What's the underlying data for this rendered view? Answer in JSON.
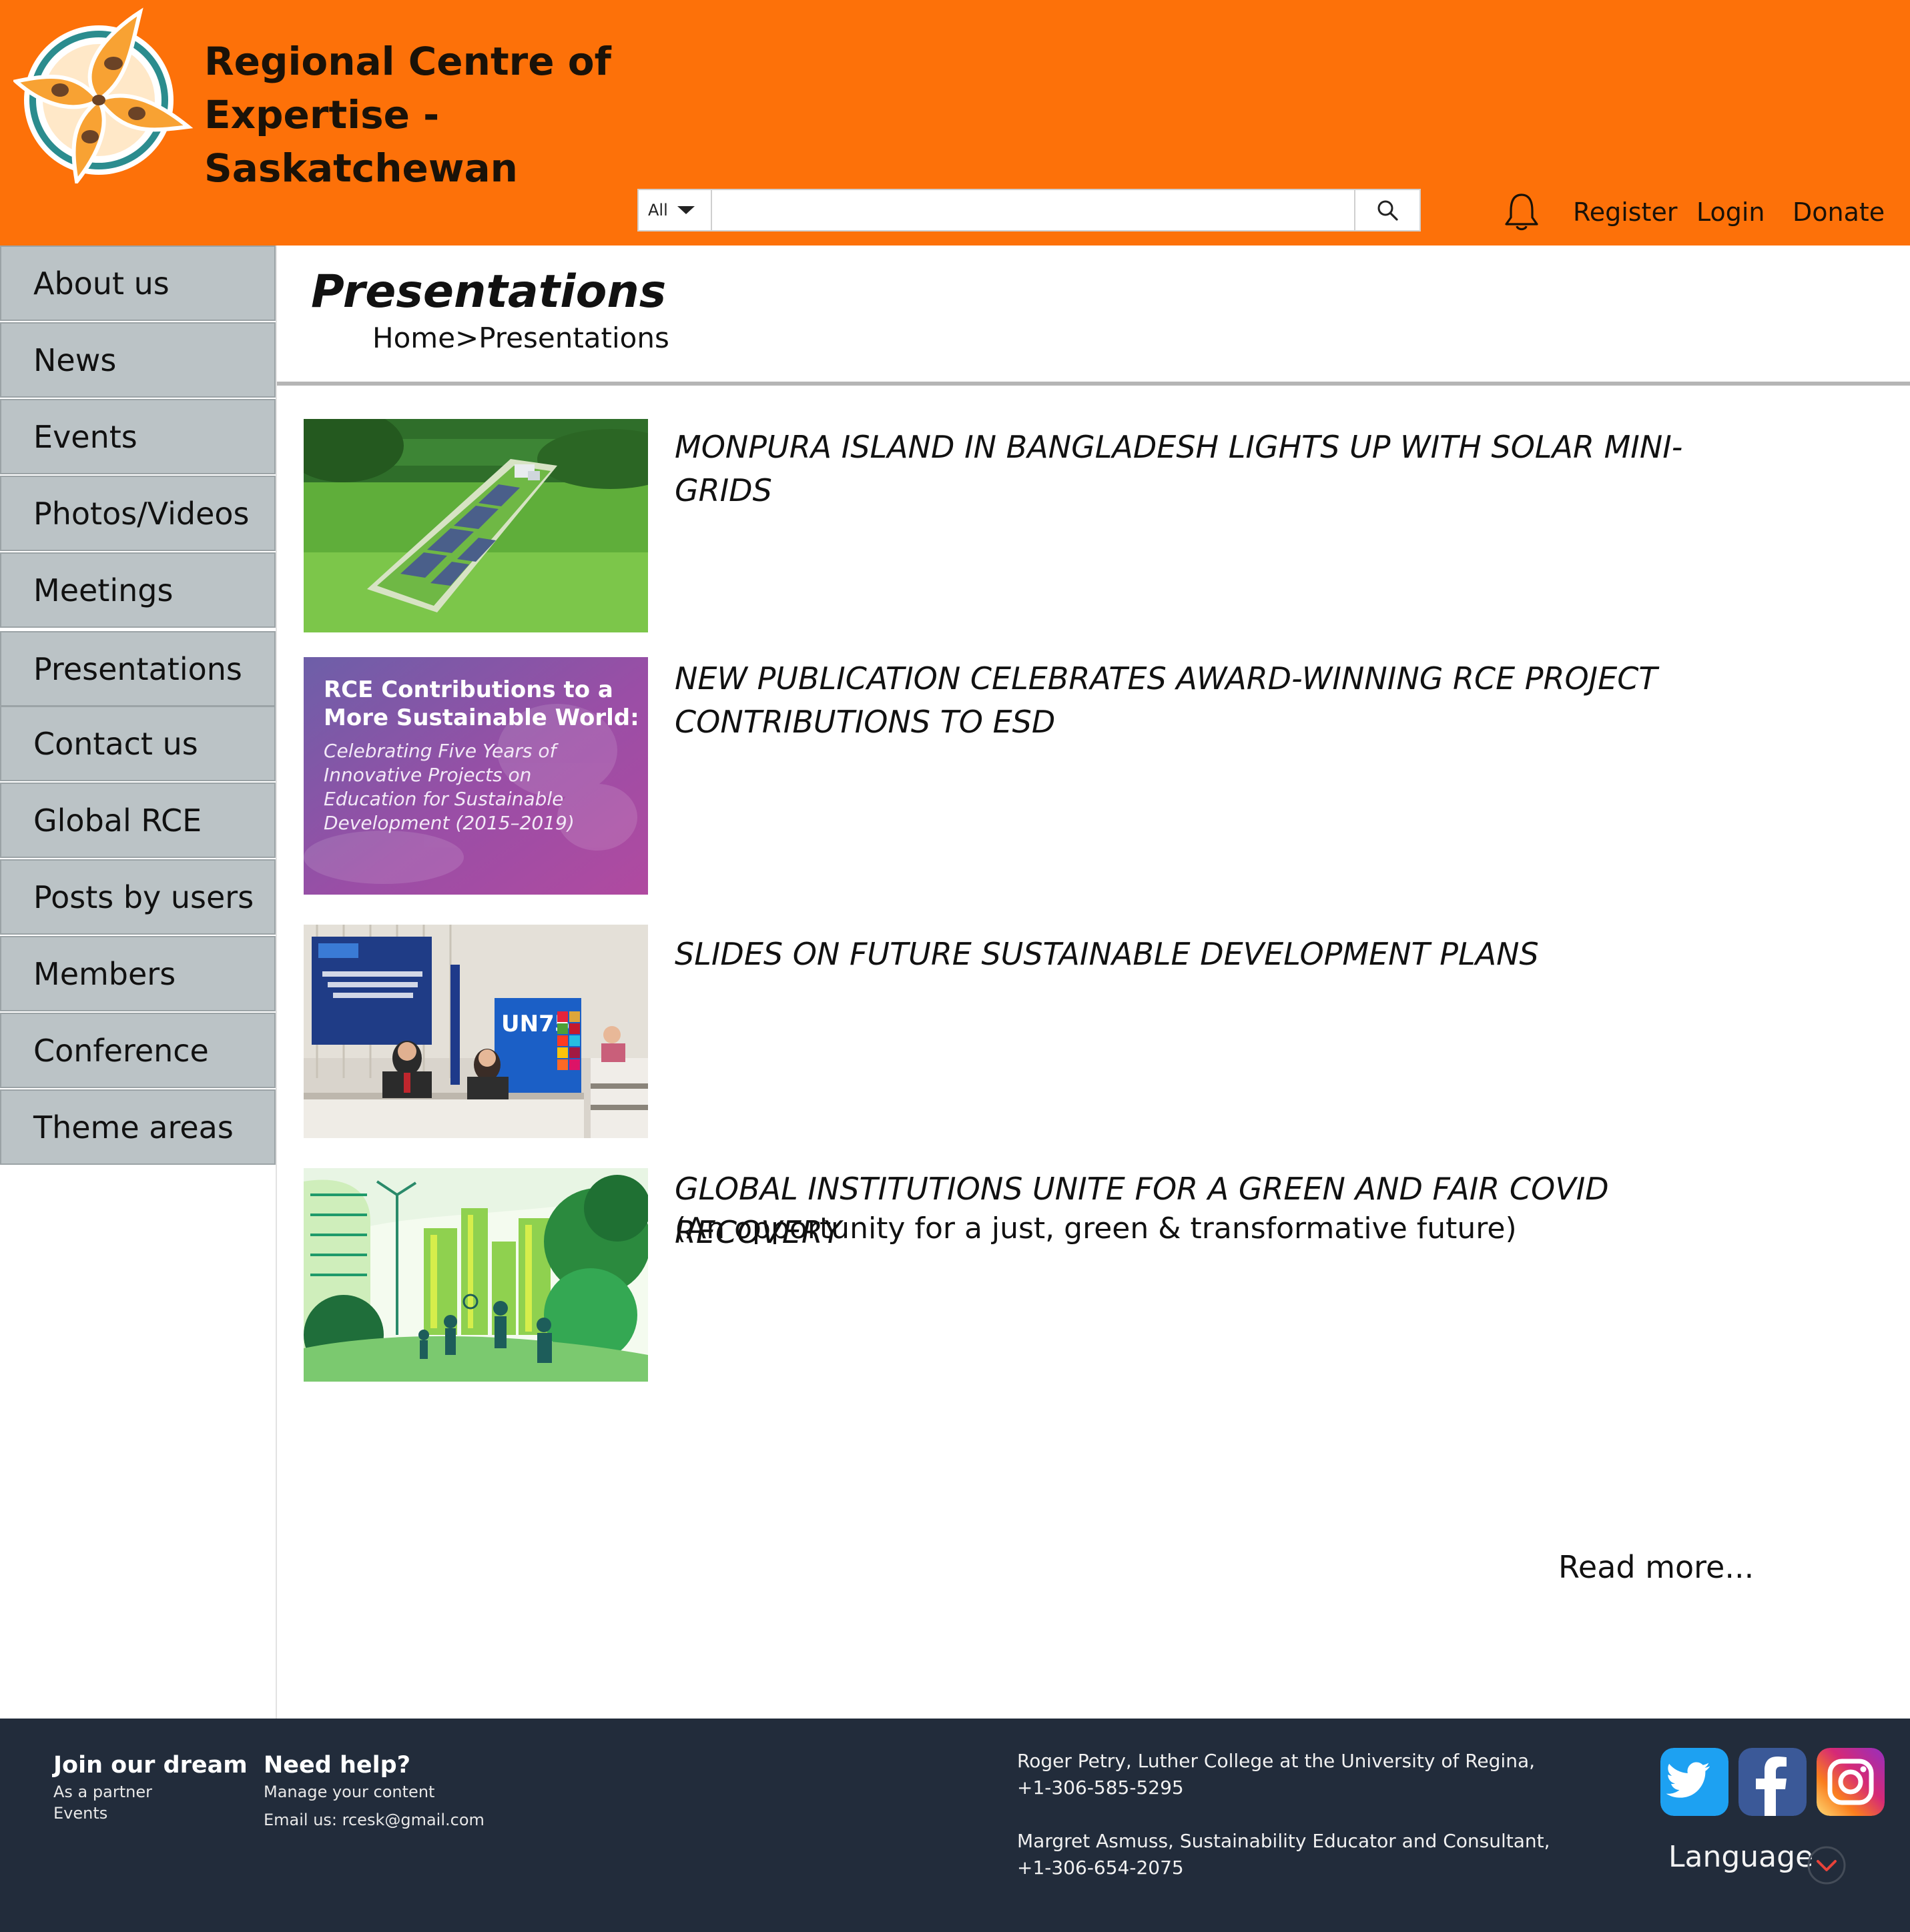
{
  "header": {
    "title_line1": "Regional Centre of Expertise -",
    "title_line2": "Saskatchewan",
    "search": {
      "category": "All",
      "placeholder": ""
    },
    "links": {
      "register": "Register",
      "login": "Login",
      "donate": "Donate"
    }
  },
  "sidebar": {
    "items": [
      {
        "label": "About us"
      },
      {
        "label": "News"
      },
      {
        "label": "Events"
      },
      {
        "label": "Photos/Videos"
      },
      {
        "label": "Meetings"
      },
      {
        "label": "Presentations"
      },
      {
        "label": "Contact us"
      },
      {
        "label": "Global RCE"
      },
      {
        "label": "Posts by users"
      },
      {
        "label": "Members"
      },
      {
        "label": "Conference"
      },
      {
        "label": "Theme areas"
      }
    ]
  },
  "main": {
    "page_title": "Presentations",
    "breadcrumb": "Home>Presentations",
    "items": [
      {
        "title": "MONPURA ISLAND IN BANGLADESH LIGHTS UP WITH SOLAR MINI-GRIDS"
      },
      {
        "title": "NEW PUBLICATION CELEBRATES AWARD-WINNING RCE PROJECT CONTRIBUTIONS TO ESD",
        "thumb_heading_1": "RCE Contributions to a",
        "thumb_heading_2": "More Sustainable World:",
        "thumb_sub_1": "Celebrating Five Years of",
        "thumb_sub_2": "Innovative Projects on",
        "thumb_sub_3": "Education for Sustainable",
        "thumb_sub_4": "Development (2015–2019)"
      },
      {
        "title": "SLIDES ON FUTURE SUSTAINABLE DEVELOPMENT PLANS",
        "thumb_banner": "UN75"
      },
      {
        "title": "GLOBAL INSTITUTIONS UNITE FOR A GREEN AND FAIR COVID RECOVERY",
        "subtitle": "(An opportunity for a just, green & transformative future)"
      }
    ],
    "read_more": "Read more..."
  },
  "footer": {
    "join": {
      "heading": "Join our dream",
      "link1": "As a partner",
      "link2": "Events"
    },
    "help": {
      "heading": "Need help?",
      "link1": "Manage your content",
      "email": "Email us: rcesk@gmail.com"
    },
    "contacts": [
      {
        "line1": "Roger Petry, Luther College at the University of Regina,",
        "line2": "+1-306-585-5295"
      },
      {
        "line1": "Margret Asmuss, Sustainability Educator and Consultant,",
        "line2": "+1-306-654-2075"
      }
    ],
    "language": "Language",
    "social": [
      "twitter-icon",
      "facebook-icon",
      "instagram-icon"
    ]
  },
  "colors": {
    "header_bg": "#fd7109",
    "sidebar_bg": "#bbc3c6",
    "footer_bg": "#222c3b"
  }
}
